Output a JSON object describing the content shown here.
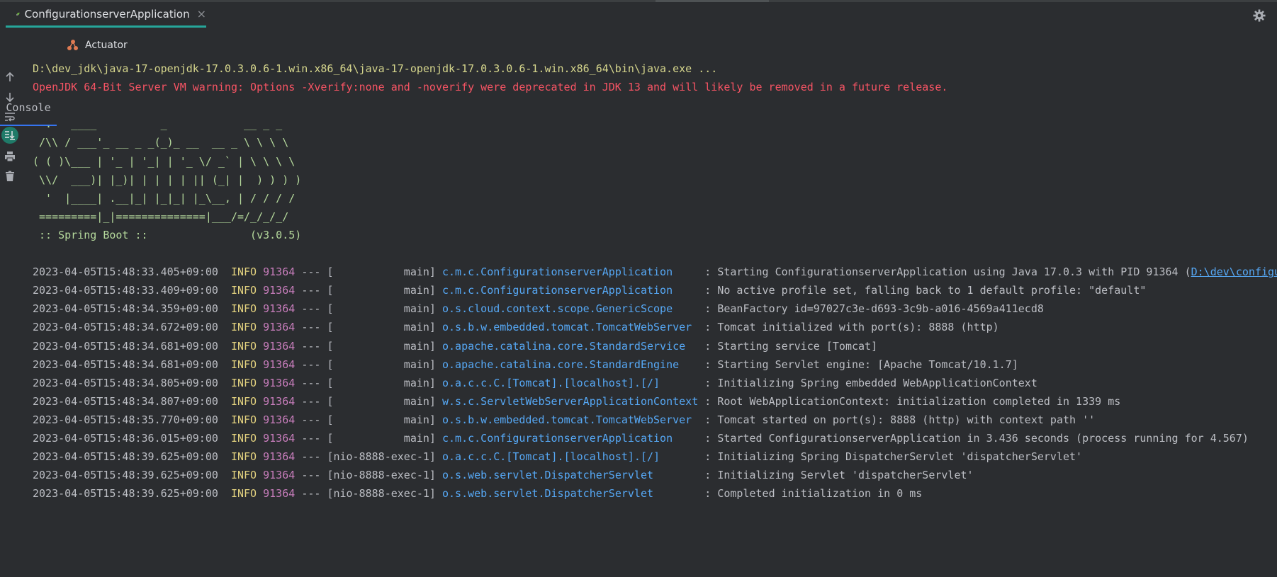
{
  "window": {
    "run_tab_title": "ConfigurationserverApplication",
    "run_tab_close": "×"
  },
  "subtabs": {
    "console": "Console",
    "actuator": "Actuator"
  },
  "sidebar": {
    "icons": [
      "arrow-up-icon",
      "arrow-down-icon",
      "soft-wrap-icon",
      "scroll-to-end-icon",
      "print-icon",
      "trash-icon"
    ]
  },
  "console": {
    "command": "D:\\dev_jdk\\java-17-openjdk-17.0.3.0.6-1.win.x86_64\\java-17-openjdk-17.0.3.0.6-1.win.x86_64\\bin\\java.exe ...",
    "warning": "OpenJDK 64-Bit Server VM warning: Options -Xverify:none and -noverify were deprecated in JDK 13 and will likely be removed in a future release.",
    "banner": [
      "  .   ____          _            __ _ _",
      " /\\\\ / ___'_ __ _ _(_)_ __  __ _ \\ \\ \\ \\",
      "( ( )\\___ | '_ | '_| | '_ \\/ _` | \\ \\ \\ \\",
      " \\\\/  ___)| |_)| | | | | || (_| |  ) ) ) )",
      "  '  |____| .__|_| |_|_| |_\\__, | / / / /",
      " =========|_|==============|___/=/_/_/_/"
    ],
    "spring_boot_label": " :: Spring Boot ::                (v3.0.5)",
    "logs": [
      {
        "ts": "2023-04-05T15:48:33.405+09:00",
        "level": "INFO",
        "pid": "91364",
        "sep": "---",
        "thread": "[           main]",
        "logger": "c.m.c.ConfigurationserverApplication    ",
        "msg": ": Starting ConfigurationserverApplication using Java 17.0.3 with PID 91364 (",
        "link": "D:\\dev\\configu"
      },
      {
        "ts": "2023-04-05T15:48:33.409+09:00",
        "level": "INFO",
        "pid": "91364",
        "sep": "---",
        "thread": "[           main]",
        "logger": "c.m.c.ConfigurationserverApplication    ",
        "msg": ": No active profile set, falling back to 1 default profile: \"default\""
      },
      {
        "ts": "2023-04-05T15:48:34.359+09:00",
        "level": "INFO",
        "pid": "91364",
        "sep": "---",
        "thread": "[           main]",
        "logger": "o.s.cloud.context.scope.GenericScope    ",
        "msg": ": BeanFactory id=97027c3e-d693-3c9b-a016-4569a411ecd8"
      },
      {
        "ts": "2023-04-05T15:48:34.672+09:00",
        "level": "INFO",
        "pid": "91364",
        "sep": "---",
        "thread": "[           main]",
        "logger": "o.s.b.w.embedded.tomcat.TomcatWebServer ",
        "msg": ": Tomcat initialized with port(s): 8888 (http)"
      },
      {
        "ts": "2023-04-05T15:48:34.681+09:00",
        "level": "INFO",
        "pid": "91364",
        "sep": "---",
        "thread": "[           main]",
        "logger": "o.apache.catalina.core.StandardService  ",
        "msg": ": Starting service [Tomcat]"
      },
      {
        "ts": "2023-04-05T15:48:34.681+09:00",
        "level": "INFO",
        "pid": "91364",
        "sep": "---",
        "thread": "[           main]",
        "logger": "o.apache.catalina.core.StandardEngine   ",
        "msg": ": Starting Servlet engine: [Apache Tomcat/10.1.7]"
      },
      {
        "ts": "2023-04-05T15:48:34.805+09:00",
        "level": "INFO",
        "pid": "91364",
        "sep": "---",
        "thread": "[           main]",
        "logger": "o.a.c.c.C.[Tomcat].[localhost].[/]      ",
        "msg": ": Initializing Spring embedded WebApplicationContext"
      },
      {
        "ts": "2023-04-05T15:48:34.807+09:00",
        "level": "INFO",
        "pid": "91364",
        "sep": "---",
        "thread": "[           main]",
        "logger": "w.s.c.ServletWebServerApplicationContext",
        "msg": ": Root WebApplicationContext: initialization completed in 1339 ms"
      },
      {
        "ts": "2023-04-05T15:48:35.770+09:00",
        "level": "INFO",
        "pid": "91364",
        "sep": "---",
        "thread": "[           main]",
        "logger": "o.s.b.w.embedded.tomcat.TomcatWebServer ",
        "msg": ": Tomcat started on port(s): 8888 (http) with context path ''"
      },
      {
        "ts": "2023-04-05T15:48:36.015+09:00",
        "level": "INFO",
        "pid": "91364",
        "sep": "---",
        "thread": "[           main]",
        "logger": "c.m.c.ConfigurationserverApplication    ",
        "msg": ": Started ConfigurationserverApplication in 3.436 seconds (process running for 4.567)"
      },
      {
        "ts": "2023-04-05T15:48:39.625+09:00",
        "level": "INFO",
        "pid": "91364",
        "sep": "---",
        "thread": "[nio-8888-exec-1]",
        "logger": "o.a.c.c.C.[Tomcat].[localhost].[/]      ",
        "msg": ": Initializing Spring DispatcherServlet 'dispatcherServlet'"
      },
      {
        "ts": "2023-04-05T15:48:39.625+09:00",
        "level": "INFO",
        "pid": "91364",
        "sep": "---",
        "thread": "[nio-8888-exec-1]",
        "logger": "o.s.web.servlet.DispatcherServlet       ",
        "msg": ": Initializing Servlet 'dispatcherServlet'"
      },
      {
        "ts": "2023-04-05T15:48:39.625+09:00",
        "level": "INFO",
        "pid": "91364",
        "sep": "---",
        "thread": "[nio-8888-exec-1]",
        "logger": "o.s.web.servlet.DispatcherServlet       ",
        "msg": ": Completed initialization in 0 ms"
      }
    ]
  },
  "colors": {
    "background": "#2b2d30",
    "tab_accent": "#26a69a",
    "command": "#d5d58c",
    "warning": "#f75464",
    "spring": "#b5d99c",
    "info": "#e3d27f",
    "pid": "#c77dbb",
    "logger": "#56a8f5",
    "text": "#bcbec4"
  }
}
